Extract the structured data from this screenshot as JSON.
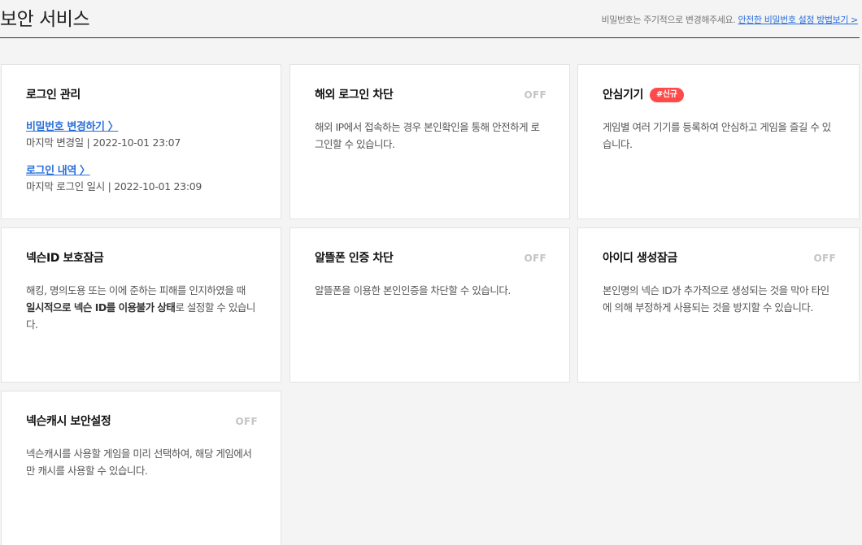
{
  "header": {
    "title": "보안 서비스",
    "note": "비밀번호는 주기적으로 변경해주세요.",
    "link": "안전한 비밀번호 설정 방법보기 >"
  },
  "cards": {
    "login": {
      "title": "로그인 관리",
      "password_link": "비밀번호 변경하기 〉",
      "password_sub": "마지막 변경일 | 2022-10-01 23:07",
      "history_link": "로그인 내역 〉",
      "history_sub": "마지막 로그인 일시 | 2022-10-01 23:09"
    },
    "overseas": {
      "title": "해외 로그인 차단",
      "status": "OFF",
      "desc": "해외 IP에서 접속하는 경우 본인확인을 통해 안전하게 로그인할 수 있습니다."
    },
    "safe_device": {
      "title": "안심기기",
      "badge": "#신규",
      "desc": "게임별 여러 기기를 등록하여 안심하고 게임을 즐길 수 있습니다."
    },
    "id_lock": {
      "title": "넥슨ID 보호잠금",
      "desc_1": "해킹, 명의도용 또는 이에 준하는 피해를 인지하였을 때 ",
      "desc_bold": "일시적으로 넥슨 ID를 이용불가 상태",
      "desc_2": "로 설정할 수 있습니다."
    },
    "mvno": {
      "title": "알뜰폰 인증 차단",
      "status": "OFF",
      "desc": "알뜰폰을 이용한 본인인증을 차단할 수 있습니다."
    },
    "id_create": {
      "title": "아이디 생성잠금",
      "status": "OFF",
      "desc": "본인명의 넥슨 ID가 추가적으로 생성되는 것을 막아 타인에 의해 부정하게 사용되는 것을 방지할 수 있습니다."
    },
    "cash": {
      "title": "넥슨캐시 보안설정",
      "status": "OFF",
      "desc": "넥슨캐시를 사용할 게임을 미리 선택하여, 해당 게임에서만 캐시를 사용할 수 있습니다."
    }
  },
  "colors": {
    "link": "#2a6fdb",
    "badge": "#ff4a4a",
    "off": "#c4c4c4"
  }
}
